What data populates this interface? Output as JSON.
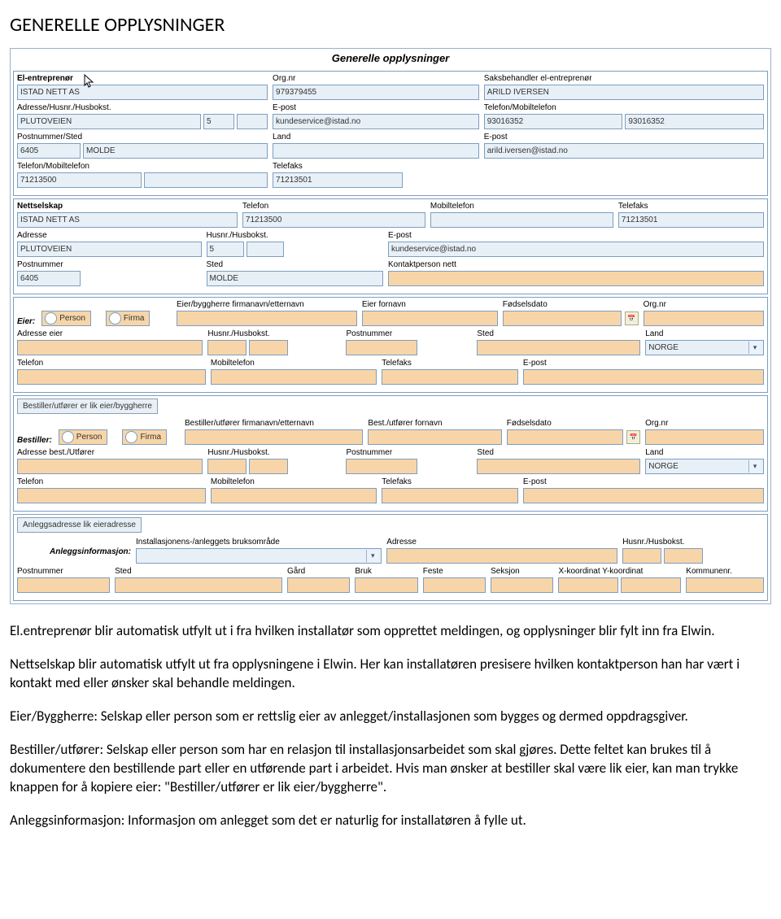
{
  "page_heading": "GENERELLE OPPLYSNINGER",
  "form_title": "Generelle opplysninger",
  "entreprenor": {
    "title": "El-entreprenør",
    "name": "ISTAD NETT AS",
    "adresse_lbl": "Adresse/Husnr./Husbokst.",
    "adresse": "PLUTOVEIEN",
    "husnr": "5",
    "husbokst": "",
    "post_lbl": "Postnummer/Sted",
    "postnr": "6405",
    "sted": "MOLDE",
    "tel_lbl": "Telefon/Mobiltelefon",
    "tel": "71213500",
    "mob": "",
    "org_lbl": "Org.nr",
    "org": "979379455",
    "epost_lbl": "E-post",
    "epost": "kundeservice@istad.no",
    "land_lbl": "Land",
    "land": "",
    "fax_lbl": "Telefaks",
    "fax": "71213501",
    "saks_lbl": "Saksbehandler el-entreprenør",
    "saks": "ARILD IVERSEN",
    "stel_lbl": "Telefon/Mobiltelefon",
    "stel": "93016352",
    "smob": "93016352",
    "sepost_lbl": "E-post",
    "sepost": "arild.iversen@istad.no"
  },
  "nettselskap": {
    "title": "Nettselskap",
    "name": "ISTAD NETT AS",
    "adresse_lbl": "Adresse",
    "adresse": "PLUTOVEIEN",
    "post_lbl": "Postnummer",
    "postnr": "6405",
    "husnr_lbl": "Husnr./Husbokst.",
    "husnr": "5",
    "husbokst": "",
    "sted_lbl": "Sted",
    "sted": "MOLDE",
    "tel_lbl": "Telefon",
    "tel": "71213500",
    "mob_lbl": "Mobiltelefon",
    "mob": "",
    "fax_lbl": "Telefaks",
    "fax": "71213501",
    "epost_lbl": "E-post",
    "epost": "kundeservice@istad.no",
    "kontakt_lbl": "Kontaktperson nett",
    "kontakt": ""
  },
  "eier": {
    "leading": "Eier:",
    "rb_person": "Person",
    "rb_firma": "Firma",
    "firma_lbl": "Eier/byggherre firmanavn/etternavn",
    "fornavn_lbl": "Eier fornavn",
    "fdato_lbl": "Fødselsdato",
    "org_lbl": "Org.nr",
    "adresse_lbl": "Adresse eier",
    "husnr_lbl": "Husnr./Husbokst.",
    "post_lbl": "Postnummer",
    "sted_lbl": "Sted",
    "land_lbl": "Land",
    "land": "NORGE",
    "tel_lbl": "Telefon",
    "mob_lbl": "Mobiltelefon",
    "fax_lbl": "Telefaks",
    "epost_lbl": "E-post"
  },
  "bestiller": {
    "copy_btn": "Bestiller/utfører er lik eier/byggherre",
    "leading": "Bestiller:",
    "rb_person": "Person",
    "rb_firma": "Firma",
    "firma_lbl": "Bestiller/utfører firmanavn/etternavn",
    "fornavn_lbl": "Best./utfører fornavn",
    "fdato_lbl": "Fødselsdato",
    "org_lbl": "Org.nr",
    "adresse_lbl": "Adresse best./Utfører",
    "husnr_lbl": "Husnr./Husbokst.",
    "post_lbl": "Postnummer",
    "sted_lbl": "Sted",
    "land_lbl": "Land",
    "land": "NORGE",
    "tel_lbl": "Telefon",
    "mob_lbl": "Mobiltelefon",
    "fax_lbl": "Telefaks",
    "epost_lbl": "E-post"
  },
  "anlegg": {
    "copy_btn": "Anleggsadresse lik eieradresse",
    "info_lbl": "Anleggsinformasjon:",
    "bruk_lbl": "Installasjonens-/anleggets bruksområde",
    "adresse_lbl": "Adresse",
    "husnr_lbl": "Husnr./Husbokst.",
    "post_lbl": "Postnummer",
    "sted_lbl": "Sted",
    "gard_lbl": "Gård",
    "bruk2_lbl": "Bruk",
    "feste_lbl": "Feste",
    "seksjon_lbl": "Seksjon",
    "xy_lbl": "X-koordinat Y-koordinat",
    "komm_lbl": "Kommunenr."
  },
  "body": {
    "p1": "El.entreprenør blir automatisk utfylt ut i fra hvilken installatør som opprettet meldingen, og opplysninger blir fylt inn fra Elwin.",
    "p2": "Nettselskap blir automatisk utfylt ut fra opplysningene i Elwin. Her kan installatøren presisere hvilken kontaktperson han har vært i kontakt med eller ønsker skal behandle meldingen.",
    "p3": "Eier/Byggherre:  Selskap eller person som er rettslig eier av anlegget/installasjonen som bygges og dermed oppdragsgiver.",
    "p4": "Bestiller/utfører:  Selskap eller person som har en relasjon til installasjonsarbeidet som skal gjøres. Dette feltet kan brukes til å dokumentere den bestillende part eller en utførende part i arbeidet. Hvis man ønsker at bestiller skal være lik eier, kan man trykke knappen for å kopiere eier: \"Bestiller/utfører er lik eier/byggherre\".",
    "p5": "Anleggsinformasjon: Informasjon om anlegget som det er naturlig for installatøren å fylle ut."
  }
}
